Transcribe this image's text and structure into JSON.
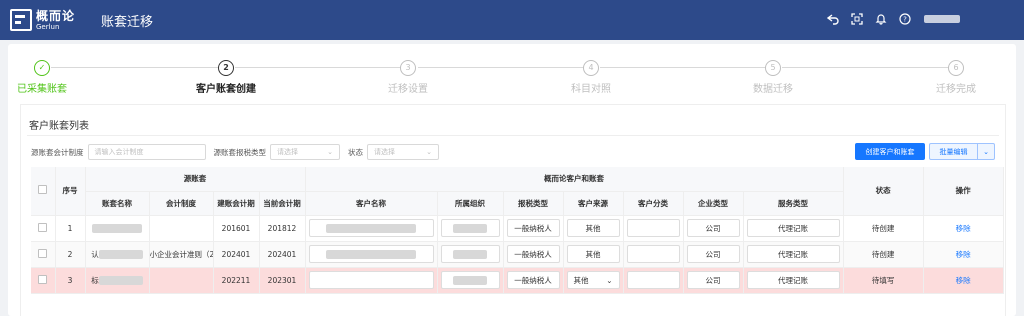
{
  "header": {
    "logo_cn": "概而论",
    "logo_en": "Gerlun",
    "title": "账套迁移",
    "icons": [
      "back-icon",
      "fullscreen-icon",
      "bell-icon",
      "help-icon"
    ]
  },
  "steps": [
    {
      "num": "✓",
      "label": "已采集账套",
      "state": "done"
    },
    {
      "num": "2",
      "label": "客户账套创建",
      "state": "active"
    },
    {
      "num": "3",
      "label": "迁移设置",
      "state": "pending"
    },
    {
      "num": "4",
      "label": "科目对照",
      "state": "pending"
    },
    {
      "num": "5",
      "label": "数据迁移",
      "state": "pending"
    },
    {
      "num": "6",
      "label": "迁移完成",
      "state": "pending"
    }
  ],
  "section": {
    "title": "客户账套列表"
  },
  "filters": {
    "source_system_label": "源账套会计制度",
    "source_system_placeholder": "请输入会计制度",
    "tax_type_label": "源账套报税类型",
    "tax_type_placeholder": "请选择",
    "status_label": "状态",
    "status_placeholder": "请选择"
  },
  "actions": {
    "create_label": "创建客户和账套",
    "batch_label": "批量编辑"
  },
  "table": {
    "group_source": "源账套",
    "group_target": "概而论客户和账套",
    "headers": {
      "seq": "序号",
      "book_name": "账套名称",
      "accounting_system": "会计制度",
      "start_period": "建账会计期",
      "current_period": "当前会计期",
      "customer_name": "客户名称",
      "org": "所属组织",
      "tax_type": "报税类型",
      "customer_source": "客户来源",
      "customer_category": "客户分类",
      "company_type": "企业类型",
      "service_type": "服务类型",
      "status": "状态",
      "operation": "操作"
    },
    "rows": [
      {
        "seq": "1",
        "book_prefix": "",
        "accounting_system": "",
        "start_period": "201601",
        "current_period": "201812",
        "tax_type": "一般纳税人",
        "customer_source": "其他",
        "customer_category": "",
        "company_type": "公司",
        "service_type": "代理记账",
        "status": "待创建",
        "operation": "移除"
      },
      {
        "seq": "2",
        "book_prefix": "认",
        "accounting_system": "小企业会计准则（2(",
        "start_period": "202401",
        "current_period": "202401",
        "tax_type": "一般纳税人",
        "customer_source": "其他",
        "customer_category": "",
        "company_type": "公司",
        "service_type": "代理记账",
        "status": "待创建",
        "operation": "移除"
      },
      {
        "seq": "3",
        "book_prefix": "标",
        "accounting_system": "",
        "start_period": "202211",
        "current_period": "202301",
        "tax_type": "一般纳税人",
        "customer_source": "其他",
        "customer_category": "",
        "company_type": "公司",
        "service_type": "代理记账",
        "status": "待填写",
        "operation": "移除"
      }
    ]
  },
  "colors": {
    "header_bg": "#2d4a8a",
    "primary": "#1677ff",
    "done": "#52c41a",
    "error_row": "#fcdcdc"
  }
}
